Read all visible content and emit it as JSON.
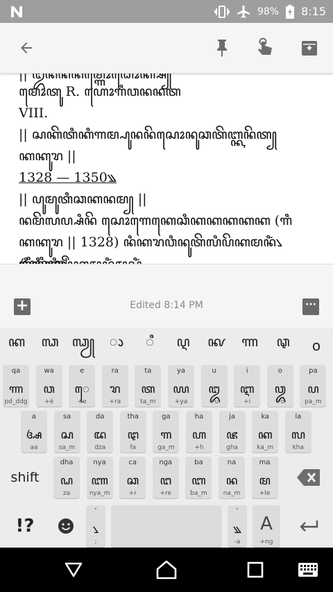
{
  "status": {
    "battery_pct": "98%",
    "time": "8:15"
  },
  "note": {
    "partial_top": "|| ꦈꦤꦶꦤꦤꦼꦩ꧀ꦒꦺꦴꦝꦺꦴꦏ꧀ꦱ꧀",
    "lines": [
      "ꦩꦺꦴꦠꦸ R. ꦲꦺꦴꦒꦶꦮꦤꦤꦠ",
      "VIII.",
      "|| ꦱꦏꦼꦠꦶꦏꦶꦒꦩ꧀ꦥꦸꦤꦤꦼꦱꦺꦴꦤꦸꦕꦠꦼꦧ꧀ꦏꦤꦼꦠ꧀",
      "ꦏꦏꦸꦫ ||",
      "1328 — 1350꧉",
      "|| ꦥꦸꦩꦸꦠꦶꦕꦏꦤꦩ꧀ ||",
      "ꦤꦩꦼꦭꦥ꧀ꦱꦶꦤꦼ ꦱꦺꦴꦒꦺꦏꦺꦕꦶꦏꦏꦏꦏꦏ (ꦒꦶ",
      "ꦏꦏꦸꦫ || 1328) ꦤꦶꦏꦫꦮꦶꦤꦸꦠꦼꦭꦶꦥꦼꦏꦩꦤꦶꦁ꧈",
      "ꦥꦿꦶꦤꦶꦏ|"
    ],
    "partial_bottom": "ꦒꦶꦤꦶꦏꦶꦥꦼꦏꦩꦤꦶꦁꦩꦸꦱꦶꦁ"
  },
  "editbar": {
    "edited": "Edited 8:14 PM"
  },
  "keyboard": {
    "suggestions": [
      "ꦏ",
      "ꦓ",
      "ꦓꦾ",
      "ꦵ",
      "ꦶ",
      "ꦉ",
      "ꦑ",
      "ꦟ",
      "ꦡ",
      "o"
    ],
    "row1": [
      {
        "top": "qa",
        "main": "ꦟ",
        "bot": "pd_ddg"
      },
      {
        "top": "wa",
        "main": "ꦮ",
        "bot": "+é"
      },
      {
        "top": "e",
        "main": "ꦺ",
        "bot": "+e"
      },
      {
        "top": "ra",
        "main": "ꦫ",
        "bot": "+ra"
      },
      {
        "top": "ta",
        "main": "ꦠ",
        "bot": "ta_m"
      },
      {
        "top": "ya",
        "main": "ꦪ",
        "bot": "+ya"
      },
      {
        "top": "u",
        "main": "ꦈ",
        "bot": "+u"
      },
      {
        "top": "i",
        "main": "ꦆ",
        "bot": "+i"
      },
      {
        "top": "o",
        "main": "ꦎ",
        "bot": "+o"
      },
      {
        "top": "pa",
        "main": "ꦥ",
        "bot": "pa_m"
      }
    ],
    "row2": [
      {
        "top": "a",
        "main": "ꦄ",
        "bot": "aa"
      },
      {
        "top": "sa",
        "main": "ꦱ",
        "bot": "sa_m"
      },
      {
        "top": "da",
        "main": "ꦢ",
        "bot": "dza"
      },
      {
        "top": "tha",
        "main": "ꦛ",
        "bot": "fa"
      },
      {
        "top": "ga",
        "main": "ꦒ",
        "bot": "ga_m"
      },
      {
        "top": "ha",
        "main": "ꦲ",
        "bot": "+h"
      },
      {
        "top": "ja",
        "main": "ꦗ",
        "bot": "gha"
      },
      {
        "top": "ka",
        "main": "ꦏ",
        "bot": "ka_m"
      },
      {
        "top": "la",
        "main": "ꦭ",
        "bot": "kha"
      }
    ],
    "row3": [
      {
        "top": "dha",
        "main": "ꦝ",
        "bot": "za"
      },
      {
        "top": "nya",
        "main": "ꦚ",
        "bot": "nya_m"
      },
      {
        "top": "ca",
        "main": "ꦕ",
        "bot": "+r"
      },
      {
        "top": "nga",
        "main": "ꦔ",
        "bot": "+re"
      },
      {
        "top": "ba",
        "main": "ꦧ",
        "bot": "ba_m"
      },
      {
        "top": "na",
        "main": "ꦤ",
        "bot": "na_m"
      },
      {
        "top": "ma",
        "main": "ꦩ",
        "bot": "+le"
      }
    ],
    "shift_label": "shift",
    "sym_label": "!?",
    "comma_key": {
      "top": "ʻ",
      "main": "꧈",
      "bot": ";"
    },
    "period_key": {
      "top": "ʻ",
      "main": "꧉",
      "bot": "-a"
    },
    "a_key": {
      "main": "A",
      "bot": "+ng"
    }
  }
}
